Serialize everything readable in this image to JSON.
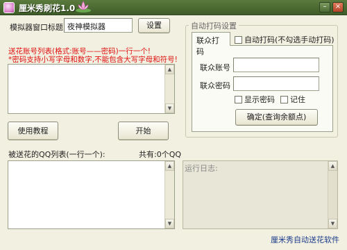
{
  "window": {
    "title": "厘米秀刷花1.0"
  },
  "form": {
    "emulator_title_label": "模拟器窗口标题",
    "emulator_title_value": "夜神模拟器",
    "settings_button": "设置",
    "accounts_hint_line1": "送花账号列表(格式:账号——密码)一行一个!",
    "accounts_hint_line2": "*密码支持小写字母和数字,不能包含大写字母和符号!",
    "tutorial_button": "使用教程",
    "start_button": "开始",
    "qq_list_label": "被送花的QQ列表(一行一个):",
    "qq_count_label": "共有:0个QQ",
    "log_label": "运行日志:",
    "footer_text": "厘米秀自动送花软件"
  },
  "captcha": {
    "group_title": "自动打码设置",
    "tab_lianzhong": "联众打码",
    "auto_checkbox_label": "自动打码(不勾选手动打码)",
    "account_label": "联众账号",
    "password_label": "联众密码",
    "show_password_label": "显示密码",
    "remember_label": "记住",
    "confirm_button": "确定(查询余额点)"
  },
  "colors": {
    "titlebar": "#4a6b32",
    "hint_text": "#e01010",
    "footer_text": "#1a3a8a"
  }
}
